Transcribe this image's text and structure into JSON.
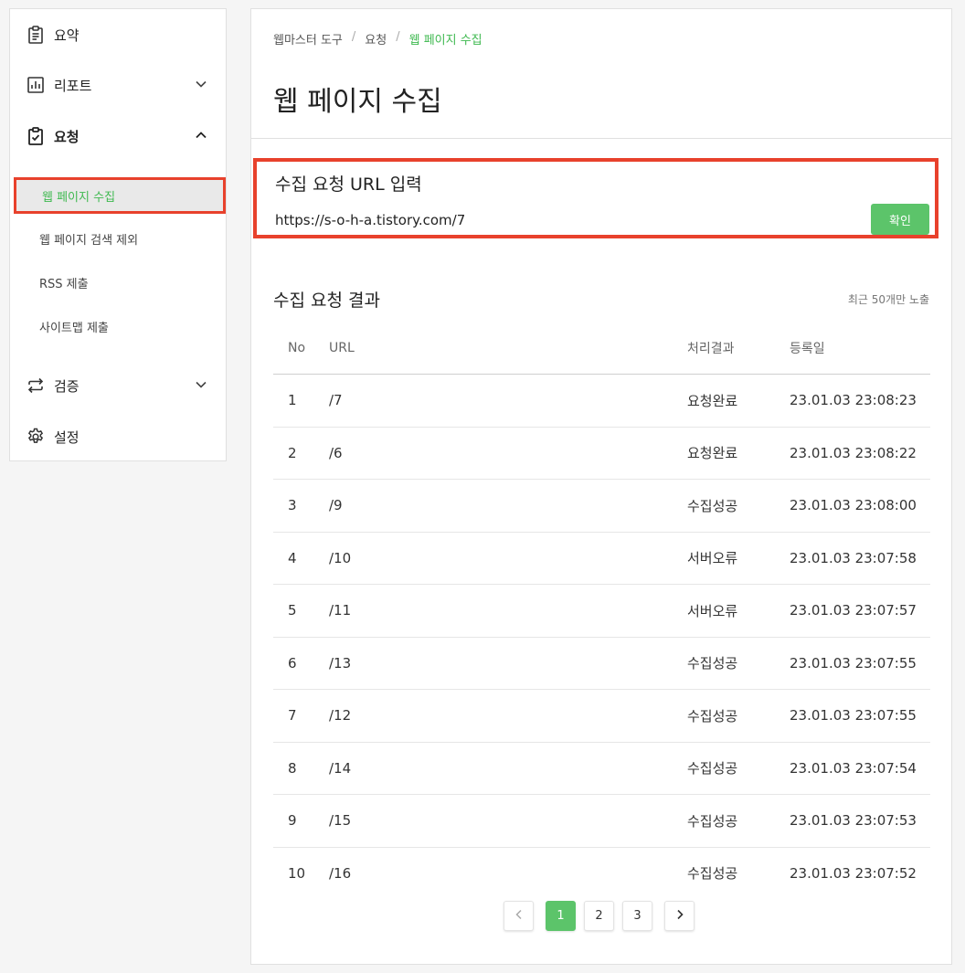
{
  "sidebar": {
    "items": [
      {
        "label": "요약",
        "icon": "clipboard-icon"
      },
      {
        "label": "리포트",
        "icon": "chart-icon"
      },
      {
        "label": "요청",
        "icon": "clipboard-check-icon"
      },
      {
        "label": "검증",
        "icon": "repeat-icon"
      },
      {
        "label": "설정",
        "icon": "gear-icon"
      }
    ],
    "sub_items": [
      {
        "label": "웹 페이지 수집",
        "active": true
      },
      {
        "label": "웹 페이지 검색 제외"
      },
      {
        "label": "RSS 제출"
      },
      {
        "label": "사이트맵 제출"
      }
    ]
  },
  "breadcrumb": [
    "웹마스터 도구",
    "요청",
    "웹 페이지 수집"
  ],
  "page_title": "웹 페이지 수집",
  "request": {
    "title": "수집 요청 URL 입력",
    "url_value": "https://s-o-h-a.tistory.com/7",
    "confirm_label": "확인"
  },
  "results": {
    "title": "수집 요청 결과",
    "note": "최근 50개만 노출",
    "columns": [
      "No",
      "URL",
      "처리결과",
      "등록일"
    ],
    "rows": [
      [
        "1",
        "/7",
        "요청완료",
        "23.01.03 23:08:23"
      ],
      [
        "2",
        "/6",
        "요청완료",
        "23.01.03 23:08:22"
      ],
      [
        "3",
        "/9",
        "수집성공",
        "23.01.03 23:08:00"
      ],
      [
        "4",
        "/10",
        "서버오류",
        "23.01.03 23:07:58"
      ],
      [
        "5",
        "/11",
        "서버오류",
        "23.01.03 23:07:57"
      ],
      [
        "6",
        "/13",
        "수집성공",
        "23.01.03 23:07:55"
      ],
      [
        "7",
        "/12",
        "수집성공",
        "23.01.03 23:07:55"
      ],
      [
        "8",
        "/14",
        "수집성공",
        "23.01.03 23:07:54"
      ],
      [
        "9",
        "/15",
        "수집성공",
        "23.01.03 23:07:53"
      ],
      [
        "10",
        "/16",
        "수집성공",
        "23.01.03 23:07:52"
      ]
    ]
  },
  "pagination": {
    "pages": [
      "1",
      "2",
      "3"
    ],
    "current": "1"
  },
  "colors": {
    "accent": "#5cc46a",
    "highlight": "#e8412c"
  }
}
